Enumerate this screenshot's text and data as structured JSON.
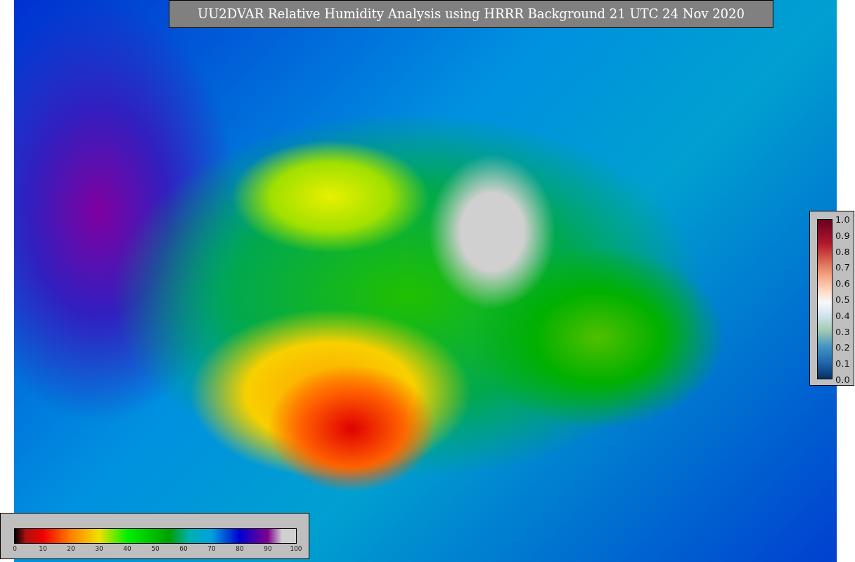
{
  "title": "UU2DVAR Relative Humidity Analysis using HRRR Background 21 UTC 24 Nov 2020",
  "right_colorbar": {
    "ticks": [
      "1.0",
      "0.9",
      "0.8",
      "0.7",
      "0.6",
      "0.5",
      "0.4",
      "0.3",
      "0.2",
      "0.1",
      "0.0"
    ]
  },
  "bottom_colorbar": {
    "ticks": [
      "0",
      "10",
      "20",
      "30",
      "40",
      "50",
      "60",
      "70",
      "80",
      "90",
      "100"
    ]
  }
}
